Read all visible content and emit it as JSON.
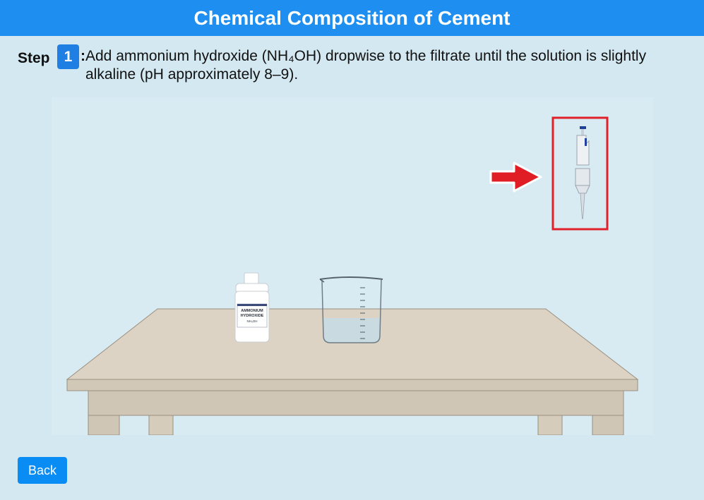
{
  "header": {
    "title": "Chemical Composition of Cement"
  },
  "step": {
    "label": "Step",
    "number": "1",
    "separator": ":",
    "instruction": "Add ammonium hydroxide (NH₄OH) dropwise to the filtrate until the solution is slightly alkaline (pH approximately 8–9)."
  },
  "bottle": {
    "label_line1": "AMMONIUM",
    "label_line2": "HYDROXIDE",
    "label_line3": "NH₄OH"
  },
  "footer": {
    "back_label": "Back"
  },
  "colors": {
    "header_bg": "#1e8ff0",
    "badge_bg": "#1f7fe3",
    "highlight_box": "#e0202a",
    "arrow": "#e01c24",
    "back_button": "#0a8cf5"
  }
}
